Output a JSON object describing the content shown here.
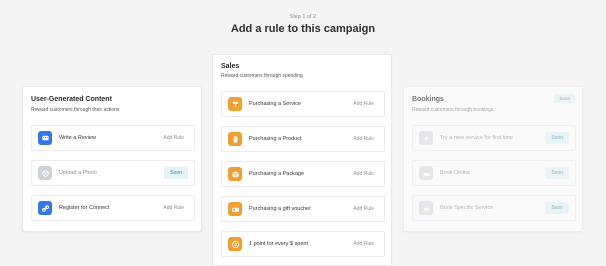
{
  "header": {
    "step": "Step 1 of 2",
    "title": "Add a rule to this campaign"
  },
  "ugc": {
    "title": "User-Generated Content",
    "subtitle": "Reward customers through their actions",
    "items": [
      {
        "label": "Write a Review",
        "action": "Add Rule",
        "icon": "review-icon"
      },
      {
        "label": "Upload a Photo",
        "action": "Soon",
        "icon": "camera-icon"
      },
      {
        "label": "Register for Connect",
        "action": "Add Rule",
        "icon": "link-icon"
      }
    ]
  },
  "sales": {
    "title": "Sales",
    "subtitle": "Reward customers through spending",
    "items": [
      {
        "label": "Purchasing a Service",
        "action": "Add Rule",
        "icon": "service-icon"
      },
      {
        "label": "Purchasing a Product",
        "action": "Add Rule",
        "icon": "product-icon"
      },
      {
        "label": "Purchasing a Package",
        "action": "Add Rule",
        "icon": "package-icon"
      },
      {
        "label": "Purchasing a gift voucher",
        "action": "Add Rule",
        "icon": "voucher-icon"
      },
      {
        "label": "1 point for every $ spent",
        "action": "Add Rule",
        "icon": "dollar-icon"
      }
    ]
  },
  "bookings": {
    "title": "Bookings",
    "subtitle": "Reward customers through bookings",
    "badge": "Soon",
    "items": [
      {
        "label": "Try a new service for first time",
        "action": "Soon",
        "icon": "sparkle-icon"
      },
      {
        "label": "Book Online",
        "action": "Soon",
        "icon": "calendar-icon"
      },
      {
        "label": "Book Specific Service",
        "action": "Soon",
        "icon": "service-bell-icon"
      }
    ]
  },
  "colors": {
    "background": "#f4f4f5",
    "blue": "#3578e5",
    "orange": "#f0a033",
    "soon_text": "#3b8fa3",
    "soon_bg": "#e4f3f6"
  }
}
